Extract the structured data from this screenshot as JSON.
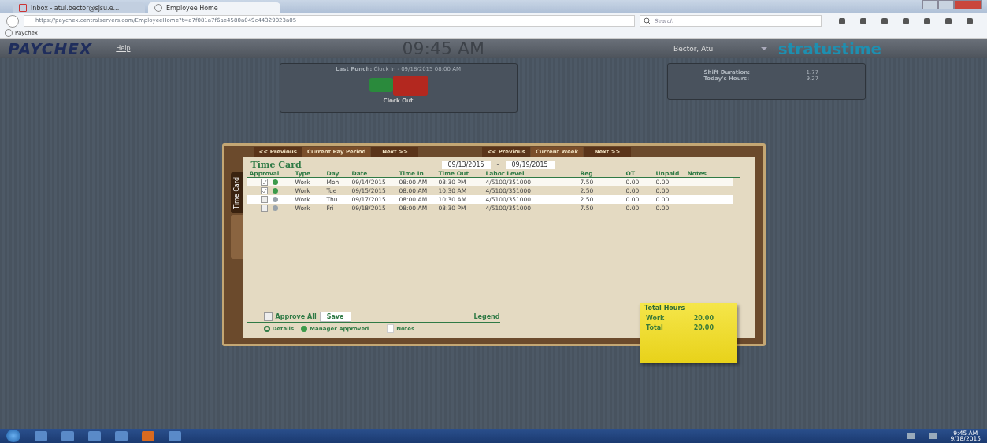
{
  "browser": {
    "tabs": [
      {
        "label": "Inbox - atul.bector@sjsu.e...",
        "selected": false
      },
      {
        "label": "Employee Home",
        "selected": true
      }
    ],
    "address": "https://paychex.centralservers.com/EmployeeHome?t=a7f081a7f6ae4580a049c44329023a05",
    "search": {
      "placeholder": "Search"
    },
    "bookmark": "Paychex"
  },
  "header": {
    "logo": "PAYCHEX",
    "help": "Help",
    "clock": "09:45 AM",
    "user": "Bector, Atul",
    "brand": "stratustime"
  },
  "punch": {
    "label": "Last Punch:",
    "value": "Clock In - 09/18/2015 08:00 AM",
    "action": "Clock Out"
  },
  "hours": [
    {
      "label": "Shift Duration:",
      "value": "1.77"
    },
    {
      "label": "Today's Hours:",
      "value": "9.27"
    }
  ],
  "nav": [
    {
      "label": "<< Previous",
      "selected": false
    },
    {
      "label": "Current Pay Period",
      "selected": true
    },
    {
      "label": "Next >>",
      "selected": false
    },
    {
      "label": "<< Previous",
      "selected": false
    },
    {
      "label": "Current Week",
      "selected": true
    },
    {
      "label": "Next >>",
      "selected": false
    }
  ],
  "side_tabs": [
    {
      "label": "Time Card",
      "selected": true
    }
  ],
  "timecard": {
    "title": "Time Card",
    "start": "09/13/2015",
    "sep": "-",
    "end": "09/19/2015",
    "columns": [
      "Approval",
      "Type",
      "Day",
      "Date",
      "Time In",
      "Time Out",
      "Labor Level",
      "Reg",
      "OT",
      "Unpaid",
      "Notes"
    ],
    "rows": [
      {
        "checked": true,
        "approved": true,
        "selected": false,
        "type": "Work",
        "day": "Mon",
        "date": "09/14/2015",
        "in": "08:00 AM",
        "out": "03:30 PM",
        "labor": "4/5100/351000",
        "reg": "7.50",
        "ot": "0.00",
        "unpaid": "0.00"
      },
      {
        "checked": true,
        "approved": true,
        "selected": false,
        "type": "Work",
        "day": "Tue",
        "date": "09/15/2015",
        "in": "08:00 AM",
        "out": "10:30 AM",
        "labor": "4/5100/351000",
        "reg": "2.50",
        "ot": "0.00",
        "unpaid": "0.00"
      },
      {
        "checked": false,
        "approved": false,
        "selected": true,
        "type": "Work",
        "day": "Thu",
        "date": "09/17/2015",
        "in": "08:00 AM",
        "out": "10:30 AM",
        "labor": "4/5100/351000",
        "reg": "2.50",
        "ot": "0.00",
        "unpaid": "0.00"
      },
      {
        "checked": false,
        "approved": false,
        "selected": false,
        "type": "Work",
        "day": "Fri",
        "date": "09/18/2015",
        "in": "08:00 AM",
        "out": "03:30 PM",
        "labor": "4/5100/351000",
        "reg": "7.50",
        "ot": "0.00",
        "unpaid": "0.00"
      }
    ],
    "approve_all": {
      "label": "Approve All",
      "checked": false
    },
    "save": "Save",
    "legend": "Legend",
    "legend_items": [
      "Details",
      "Manager Approved",
      "Notes"
    ]
  },
  "total_hours": {
    "title": "Total Hours",
    "rows": [
      {
        "label": "Work",
        "value": "20.00"
      },
      {
        "label": "Total",
        "value": "20.00"
      }
    ]
  },
  "taskbar": {
    "time": "9:45 AM",
    "date": "9/18/2015"
  }
}
